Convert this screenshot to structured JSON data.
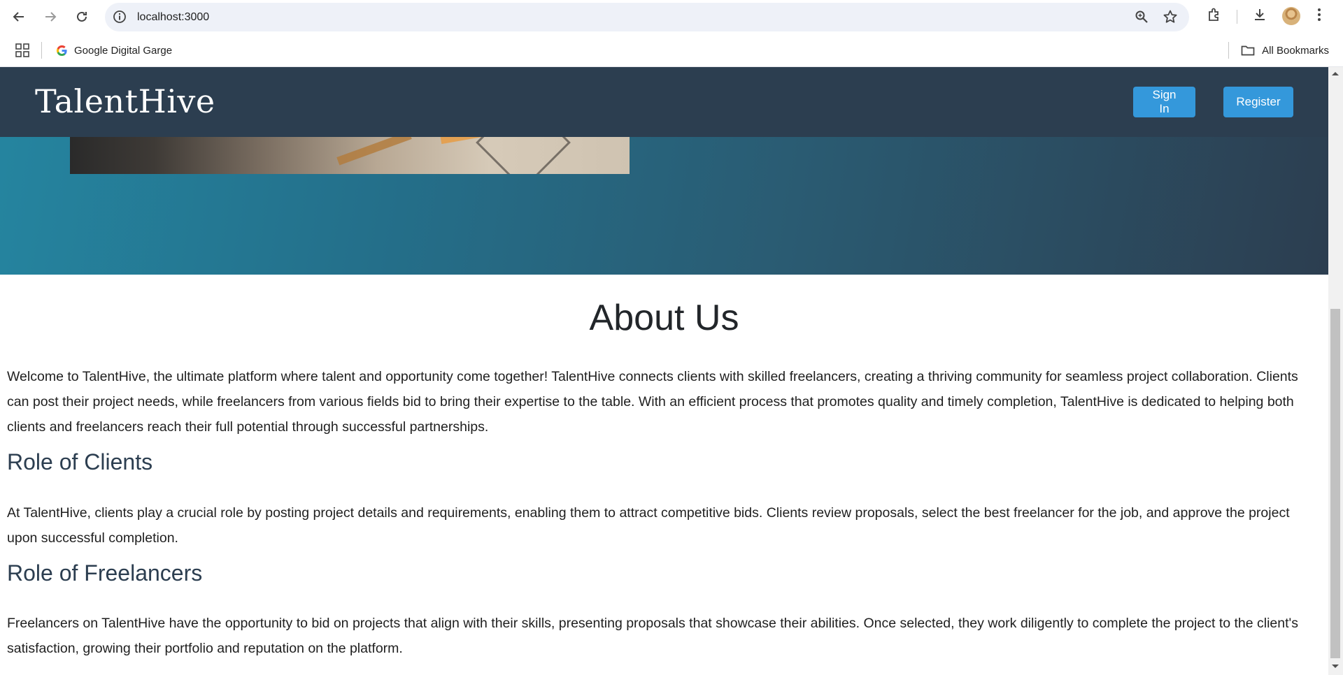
{
  "browser": {
    "url": "localhost:3000",
    "bookmarks": [
      {
        "label": "Google Digital Garge",
        "icon": "google-icon"
      }
    ],
    "all_bookmarks_label": "All Bookmarks"
  },
  "site": {
    "brand": "TalentHive",
    "sign_in_label": "Sign In",
    "register_label": "Register",
    "colors": {
      "navbar": "#2c3e50",
      "button": "#3498db",
      "hero_start": "#2585a0",
      "hero_end": "#2c3e50",
      "heading": "#2c3e50"
    }
  },
  "about": {
    "title": "About Us",
    "intro": "Welcome to TalentHive, the ultimate platform where talent and opportunity come together! TalentHive connects clients with skilled freelancers, creating a thriving community for seamless project collaboration. Clients can post their project needs, while freelancers from various fields bid to bring their expertise to the table. With an efficient process that promotes quality and timely completion, TalentHive is dedicated to helping both clients and freelancers reach their full potential through successful partnerships.",
    "clients_heading": "Role of Clients",
    "clients_text": "At TalentHive, clients play a crucial role by posting project details and requirements, enabling them to attract competitive bids. Clients review proposals, select the best freelancer for the job, and approve the project upon successful completion.",
    "freelancers_heading": "Role of Freelancers",
    "freelancers_text": "Freelancers on TalentHive have the opportunity to bid on projects that align with their skills, presenting proposals that showcase their abilities. Once selected, they work diligently to complete the project to the client's satisfaction, growing their portfolio and reputation on the platform."
  }
}
